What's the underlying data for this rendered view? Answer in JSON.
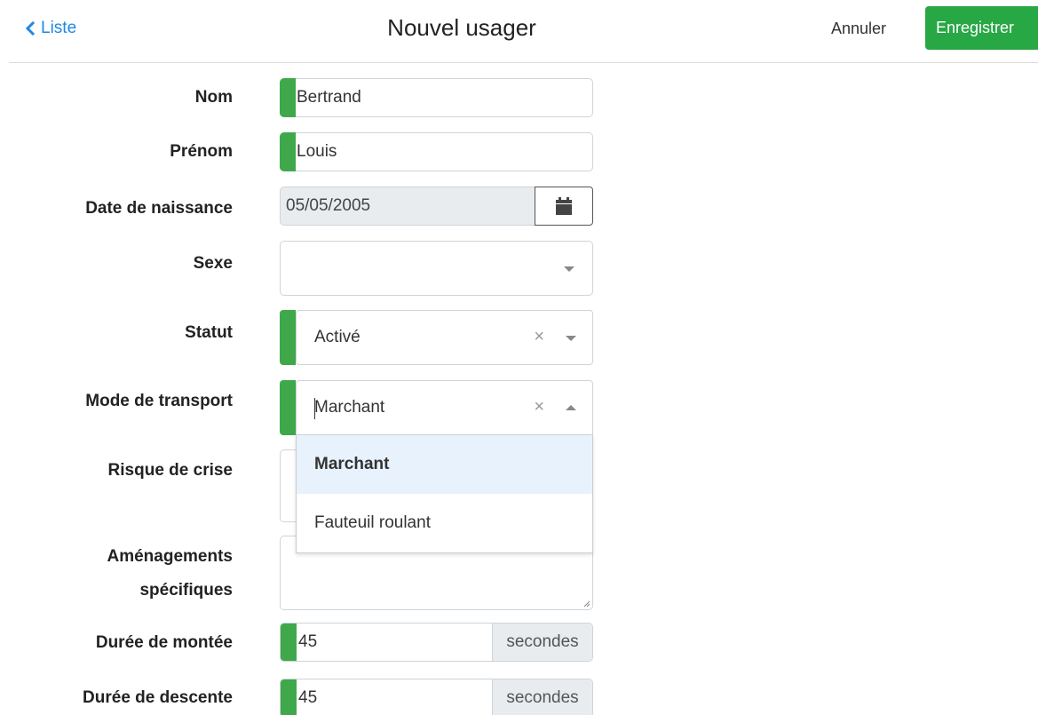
{
  "header": {
    "back_label": "Liste",
    "title": "Nouvel usager",
    "cancel_label": "Annuler",
    "save_label": "Enregistrer",
    "save_color": "#28a745"
  },
  "form": {
    "nom": {
      "label": "Nom",
      "value": "Bertrand"
    },
    "prenom": {
      "label": "Prénom",
      "value": "Louis"
    },
    "naissance": {
      "label": "Date de naissance",
      "value": "05/05/2005",
      "icon": "calendar-icon"
    },
    "sexe": {
      "label": "Sexe",
      "value": ""
    },
    "statut": {
      "label": "Statut",
      "value": "Activé"
    },
    "transport": {
      "label": "Mode de transport",
      "value": "Marchant",
      "options": [
        "Marchant",
        "Fauteuil roulant"
      ],
      "highlighted": "Marchant"
    },
    "risque": {
      "label": "Risque de crise"
    },
    "amenagements": {
      "label_line1": "Aménagements",
      "label_line2": "spécifiques",
      "value": ""
    },
    "montee": {
      "label": "Durée de montée",
      "value": "45",
      "unit": "secondes"
    },
    "descente": {
      "label": "Durée de descente",
      "value": "45",
      "unit": "secondes"
    }
  },
  "colors": {
    "required_marker": "#3fa84a",
    "link": "#1e88e5",
    "highlight": "#e8f2fd"
  }
}
